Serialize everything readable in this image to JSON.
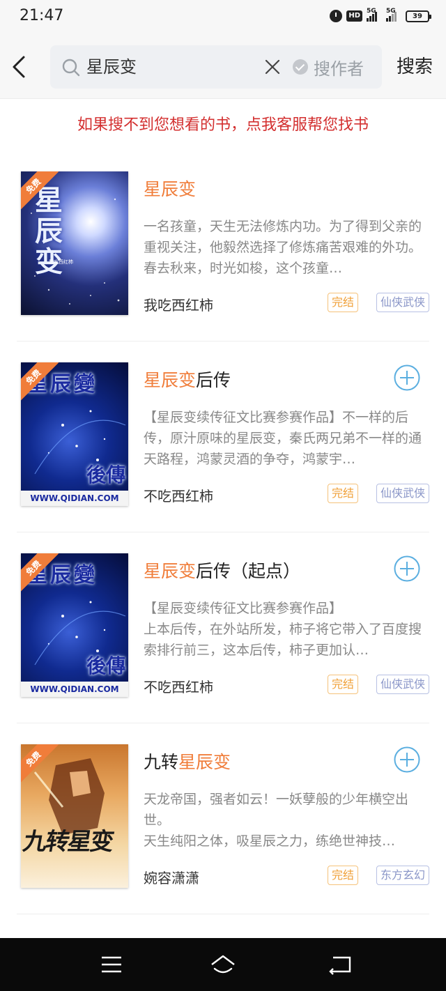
{
  "status_bar": {
    "time": "21:47",
    "hd": "HD",
    "net1": "5G",
    "net2": "5G",
    "battery": "39"
  },
  "search": {
    "query": "星辰变",
    "author_label": "搜作者",
    "button_label": "搜索"
  },
  "banner": "如果搜不到您想看的书，点我客服帮您找书",
  "books": [
    {
      "title_hl": "星辰变",
      "title_rest": "",
      "desc": "一名孩童，天生无法修炼内功。为了得到父亲的重视关注，他毅然选择了修炼痛苦艰难的外功。春去秋来，时光如梭，这个孩童…",
      "author": "我吃西红柿",
      "status": "完结",
      "genre": "仙侠武侠",
      "ribbon": "免费",
      "cover_text": "星辰变",
      "cover_author": "我吃西红柿"
    },
    {
      "title_hl": "星辰变",
      "title_rest": "后传",
      "desc": "【星辰变续传征文比赛参赛作品】不一样的后传，原汁原味的星辰变，秦氏两兄弟不一样的通天路程，鸿蒙灵酒的争夺，鸿蒙宇…",
      "author": "不吃西红柿",
      "status": "完结",
      "genre": "仙侠武侠",
      "ribbon": "免费",
      "cover_text": "星辰變",
      "cover_sub": "後傳",
      "cover_url": "WWW.QIDIAN.COM"
    },
    {
      "title_hl": "星辰变",
      "title_rest": "后传（起点）",
      "desc": "【星辰变续传征文比赛参赛作品】\n上本后传，在外站所发，柿子将它带入了百度搜索排行前三，这本后传，柿子更加认…",
      "author": "不吃西红柿",
      "status": "完结",
      "genre": "仙侠武侠",
      "ribbon": "免费",
      "cover_text": "星辰變",
      "cover_sub": "後傳",
      "cover_url": "WWW.QIDIAN.COM"
    },
    {
      "title_pre": "九转",
      "title_hl": "星辰变",
      "title_rest": "",
      "desc": "天龙帝国，强者如云！一妖孽般的少年横空出世。\n天生纯阳之体，吸星辰之力，练绝世神技…",
      "author": "婉容潇潇",
      "status": "完结",
      "genre": "东方玄幻",
      "ribbon": "免费",
      "cover_text": "九转星变"
    }
  ],
  "colors": {
    "accent": "#f07d3a",
    "banner": "#d32f2f",
    "add_button": "#5aaee0"
  }
}
